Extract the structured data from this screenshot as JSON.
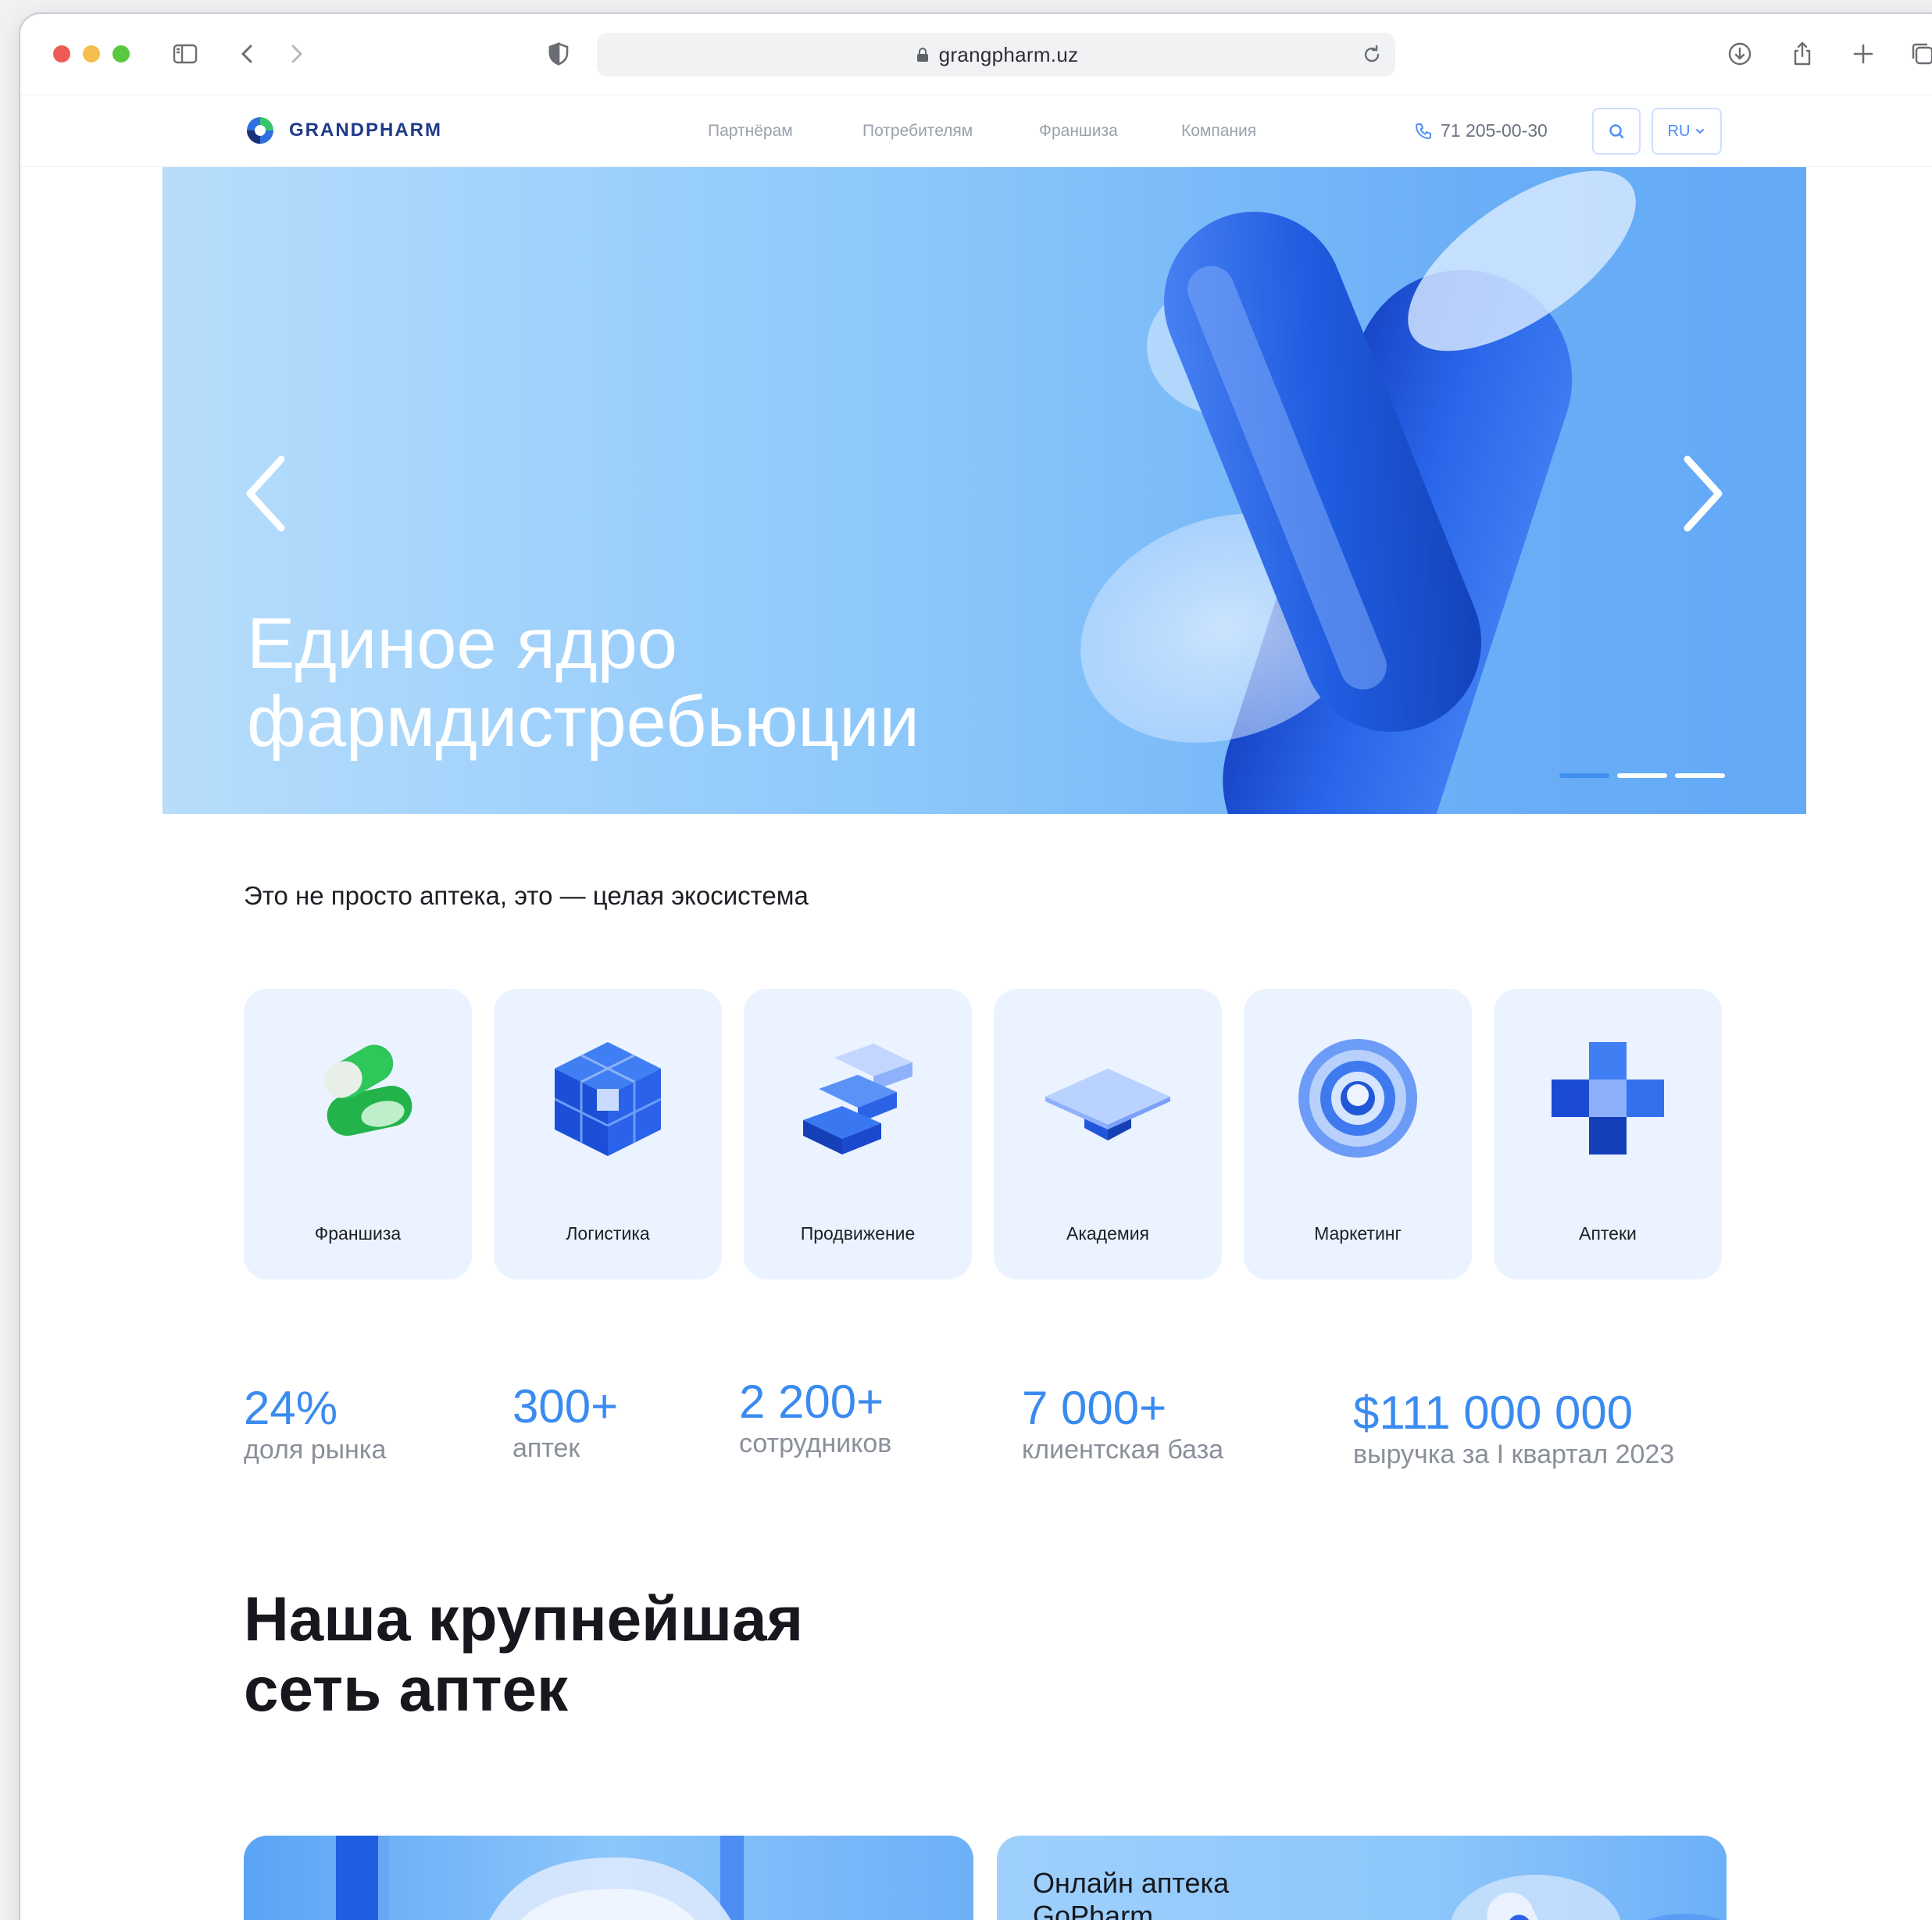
{
  "browser": {
    "url": "grangpharm.uz"
  },
  "header": {
    "brand": "GRANDPHARM",
    "nav": [
      "Партнёрам",
      "Потребителям",
      "Франшиза",
      "Компания"
    ],
    "phone": "71 205-00-30",
    "language": "RU"
  },
  "hero": {
    "title_line1": "Единое ядро",
    "title_line2": "фармдистребьюции",
    "slides_total": 3,
    "active_slide": 1
  },
  "ecosystem": {
    "title": "Это не просто аптека, это — целая экосистема",
    "cards": [
      {
        "label": "Франшиза",
        "icon": "capsule-icon"
      },
      {
        "label": "Логистика",
        "icon": "cube-icon"
      },
      {
        "label": "Продвижение",
        "icon": "stairs-icon"
      },
      {
        "label": "Академия",
        "icon": "graduation-cap-icon"
      },
      {
        "label": "Маркетинг",
        "icon": "target-ring-icon"
      },
      {
        "label": "Аптеки",
        "icon": "medical-cross-icon"
      }
    ]
  },
  "stats": [
    {
      "value": "24%",
      "caption": "доля рынка"
    },
    {
      "value": "300+",
      "caption": "аптек"
    },
    {
      "value": "2 200+",
      "caption": "сотрудников"
    },
    {
      "value": "7 000+",
      "caption": "клиентская база"
    },
    {
      "value": "$111 000 000",
      "caption": "выручка за I квартал 2023"
    }
  ],
  "network": {
    "title_line1": "Наша крупнейшая",
    "title_line2": "сеть аптек"
  },
  "promo": {
    "card2_title_line1": "Онлайн аптека",
    "card2_title_line2": "GoPharm"
  },
  "colors": {
    "accent": "#3a8bf0",
    "brand": "#1f3a8a",
    "card_bg": "#eaf3ff"
  }
}
